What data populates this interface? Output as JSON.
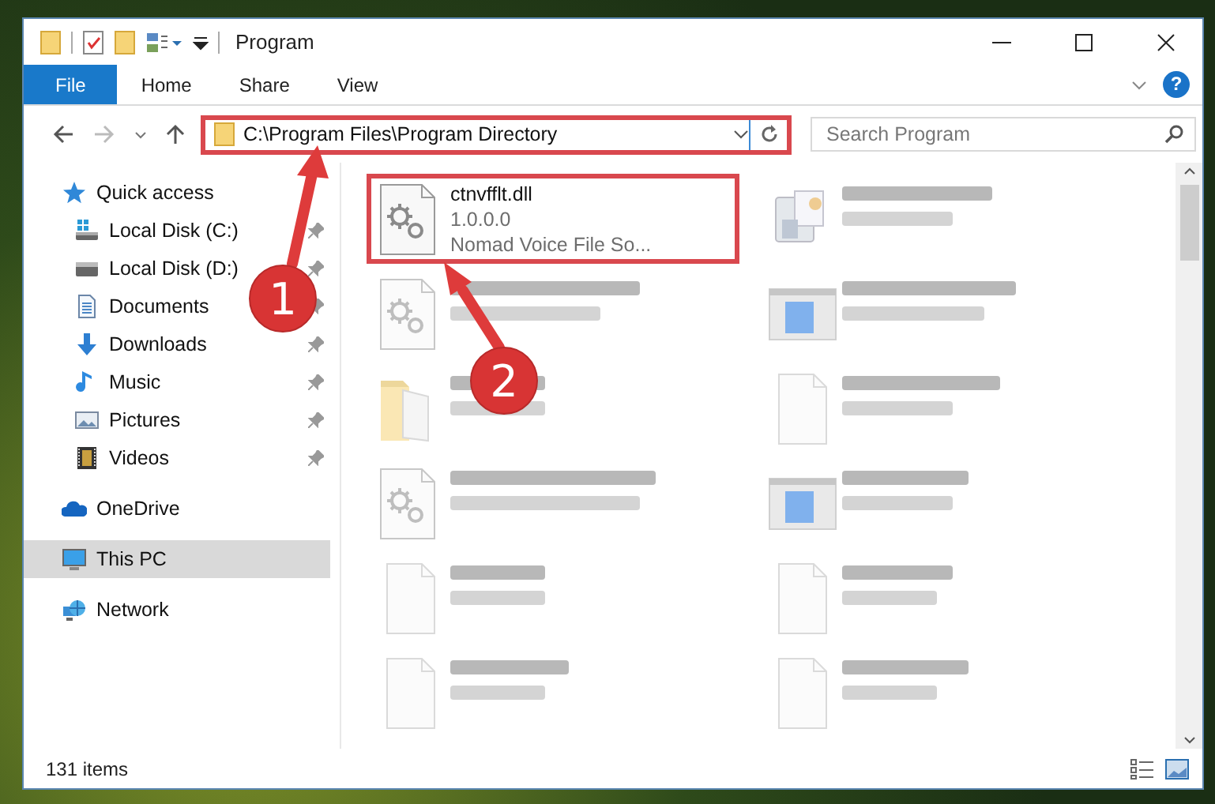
{
  "window": {
    "title": "Program"
  },
  "ribbon": {
    "tabs": [
      {
        "label": "File",
        "selected": true
      },
      {
        "label": "Home",
        "selected": false
      },
      {
        "label": "Share",
        "selected": false
      },
      {
        "label": "View",
        "selected": false
      }
    ],
    "help": "?"
  },
  "address": {
    "path": "C:\\Program Files\\Program Directory",
    "highlighted": true
  },
  "search": {
    "placeholder": "Search Program"
  },
  "sidebar": {
    "items": [
      {
        "label": "Quick access",
        "kind": "star",
        "selected": false,
        "children": [
          {
            "label": "Local Disk (C:)",
            "kind": "drive-windows",
            "pinned": true
          },
          {
            "label": "Local Disk (D:)",
            "kind": "drive",
            "pinned": true
          },
          {
            "label": "Documents",
            "kind": "documents",
            "pinned": true
          },
          {
            "label": "Downloads",
            "kind": "download",
            "pinned": true
          },
          {
            "label": "Music",
            "kind": "music",
            "pinned": true
          },
          {
            "label": "Pictures",
            "kind": "pictures",
            "pinned": true
          },
          {
            "label": "Videos",
            "kind": "videos",
            "pinned": true
          }
        ]
      },
      {
        "label": "OneDrive",
        "kind": "cloud",
        "selected": false
      },
      {
        "label": "This PC",
        "kind": "pc",
        "selected": true
      },
      {
        "label": "Network",
        "kind": "network",
        "selected": false
      }
    ]
  },
  "files": [
    {
      "name": "ctnvfflt.dll",
      "lines": [
        "1.0.0.0",
        "Nomad Voice File So..."
      ],
      "kind": "dll",
      "highlighted": true,
      "blurred": false
    },
    {
      "kind": "program",
      "blurred": true
    },
    {
      "kind": "dll",
      "blurred": true
    },
    {
      "kind": "window",
      "blurred": true
    },
    {
      "kind": "folder",
      "blurred": true
    },
    {
      "kind": "document",
      "blurred": true
    },
    {
      "kind": "dll",
      "blurred": true
    },
    {
      "kind": "window",
      "blurred": true
    },
    {
      "kind": "document",
      "blurred": true
    },
    {
      "kind": "document",
      "blurred": true
    },
    {
      "kind": "document",
      "blurred": true
    },
    {
      "kind": "document",
      "blurred": true
    }
  ],
  "status_bar": {
    "count": "131 items"
  },
  "annotations": {
    "callouts": [
      {
        "number": "1"
      },
      {
        "number": "2"
      }
    ]
  }
}
